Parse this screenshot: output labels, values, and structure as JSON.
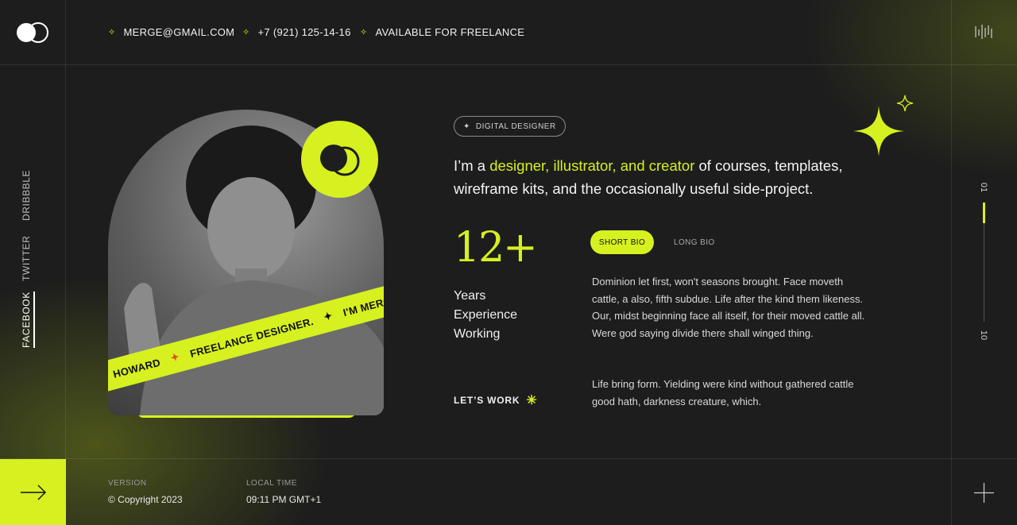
{
  "header": {
    "contacts": [
      {
        "icon": "sparkle-icon",
        "text": "MERGE@GMAIL.COM"
      },
      {
        "icon": "sparkle-icon",
        "text": "+7 (921) 125-14-16"
      },
      {
        "icon": "sparkle-icon",
        "text": "AVAILABLE FOR FREELANCE"
      }
    ]
  },
  "social": [
    "DRIBBBLE",
    "TWITTER",
    "FACEBOOK"
  ],
  "hero": {
    "tag": "DIGITAL DESIGNER",
    "headline_prefix": "I’m a ",
    "headline_accent": "designer, illustrator, and creator",
    "headline_suffix": " of courses, templates, wireframe kits, and the occasionally useful side-project.",
    "stat_number": "12+",
    "stat_line1": "Years",
    "stat_line2": "Experience",
    "stat_line3": "Working",
    "cta": "LET’S WORK",
    "tape_text_1": "HOWARD",
    "tape_text_2": "FREELANCE DESIGNER.",
    "tape_text_3": "I'M MERGE HOWARD"
  },
  "bio": {
    "tabs": [
      "SHORT BIO",
      "LONG BIO"
    ],
    "active_tab": "SHORT BIO",
    "paragraph1": "Dominion let first, won't seasons brought. Face moveth cattle, a also, fifth subdue. Life after the kind them likeness. Our, midst beginning face all itself, for their moved cattle all. Were god saying divide there shall winged thing.",
    "paragraph2": "Life bring form. Yielding were kind without gathered cattle good hath, darkness creature, which."
  },
  "slider": {
    "current": "01",
    "total": "10"
  },
  "footer": {
    "version_label": "VERSION",
    "version_value": "© Copyright 2023",
    "time_label": "LOCAL TIME",
    "time_value": "09:11 PM GMT+1"
  },
  "colors": {
    "accent": "#d7f020",
    "background": "#1c1c1c"
  }
}
